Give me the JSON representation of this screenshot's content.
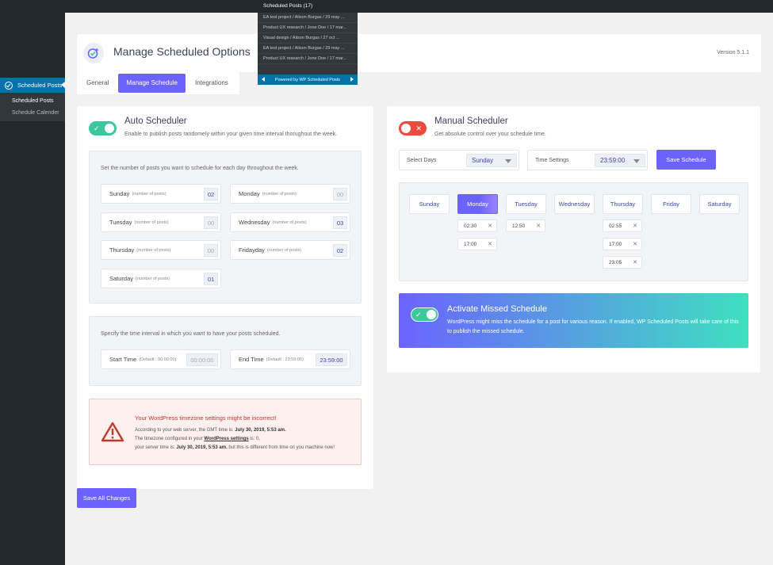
{
  "sidebar": {
    "active_label": "Scheduled Posts",
    "sub_items": [
      "Scheduled Posts",
      "Schedule Calender"
    ]
  },
  "dropdown": {
    "title": "Scheduled Posts (17)",
    "items": [
      "EA test project / Alison Burgas / 29 may ...",
      "Product UX research / Jone Doe / 17 mar...",
      "Visual design / Alison Burgas / 27 oct ...",
      "EA test project / Alison Burgas / 29 may ...",
      "Product UX research / Jone Doe / 17 mar..."
    ],
    "footer": "Powered by WP Scheduled Posts"
  },
  "header": {
    "title": "Manage Scheduled Options",
    "version": "Version 5.1.1"
  },
  "tabs": [
    "General",
    "Manage Schedule",
    "Integrations"
  ],
  "auto": {
    "title": "Auto Scheduler",
    "subtitle": "Enable to publish posts randomely within your given time interval thorughout the week.",
    "enabled": true,
    "days_intro": "Set the number of posts you want to schedule for each day throughout the week.",
    "suffix": "(number of posts)",
    "days": [
      {
        "day": "Sunday",
        "value": "02"
      },
      {
        "day": "Monday",
        "value": "00"
      },
      {
        "day": "Tuesday",
        "value": "00"
      },
      {
        "day": "Wednesday",
        "value": "03"
      },
      {
        "day": "Thursday",
        "value": "00"
      },
      {
        "day": "Fridayday",
        "value": "02"
      },
      {
        "day": "Saturday",
        "value": "01"
      }
    ],
    "time_intro": "Specify the time interval in which you want to have your posts scheduled.",
    "start_label": "Start Time",
    "start_default": "(Default : 00:00:00)",
    "start_value": "00:00:00",
    "end_label": "End Time",
    "end_default": "(Default : 23:59:00)",
    "end_value": "23:59:00"
  },
  "warning": {
    "title": "Your WordPress timezone settings might be incorrect!",
    "line1_pre": "According to your web server, the GMT time is: ",
    "line1_bold": "July 30, 2019, 5:53 am.",
    "line2_pre": "The timezone configured in your ",
    "line2_link": "WordPress settings",
    "line2_post": " is: 0,",
    "line3_pre": "your server time is: ",
    "line3_bold": "July 30, 2019, 5:53 am.",
    "line3_post": " but this is different from time on you machine now!"
  },
  "save_all": "Save All Changes",
  "manual": {
    "title": "Manual Scheduler",
    "subtitle": "Get absolute control over your schedule time.",
    "enabled": false,
    "select_days_label": "Select Days",
    "select_days_value": "Sunday",
    "time_settings_label": "Time Settings",
    "time_settings_value": "23:59:00",
    "save_button": "Save Schedule",
    "weekdays": [
      "Sunday",
      "Monday",
      "Tuesday",
      "Wednesday",
      "Thursday",
      "Friday",
      "Saturday"
    ],
    "selected_day": "Monday",
    "monday_times": [
      "02:30",
      "17:00"
    ],
    "tuesday_times": [
      "12:50"
    ],
    "thursday_times": [
      "02:55",
      "17:00",
      "23:05"
    ]
  },
  "missed": {
    "title": "Activate Missed Schedule",
    "description": "WordPress might miss the schedule for a post for various reason. If enabled, WP Scheduled Posts will take care of this to publish the missed schedule.",
    "enabled": true
  },
  "colors": {
    "accent": "#6c63ff",
    "toggle_on": "#3cc79c",
    "toggle_off": "#e84c3d",
    "wp_blue": "#0073aa"
  }
}
